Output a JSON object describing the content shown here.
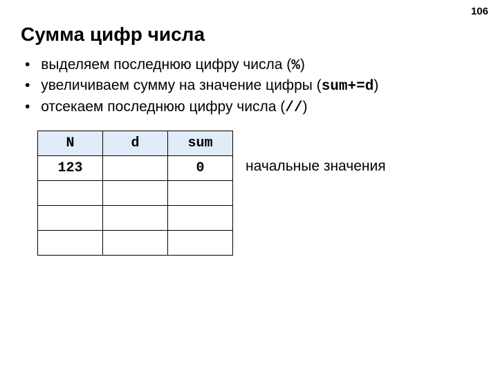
{
  "page_number": "106",
  "title": "Сумма цифр числа",
  "bullets": [
    {
      "text": "выделяем последнюю цифру числа (",
      "code": "%",
      "tail": ")"
    },
    {
      "text": "увеличиваем сумму на значение цифры (",
      "code": "sum+=d",
      "tail": ")"
    },
    {
      "text": "отсекаем последнюю цифру числа (",
      "code": "//",
      "tail": ")"
    }
  ],
  "table": {
    "headers": [
      "N",
      "d",
      "sum"
    ],
    "rows": [
      [
        "123",
        "",
        "0"
      ],
      [
        "",
        "",
        ""
      ],
      [
        "",
        "",
        ""
      ],
      [
        "",
        "",
        ""
      ]
    ]
  },
  "side_label": "начальные значения"
}
